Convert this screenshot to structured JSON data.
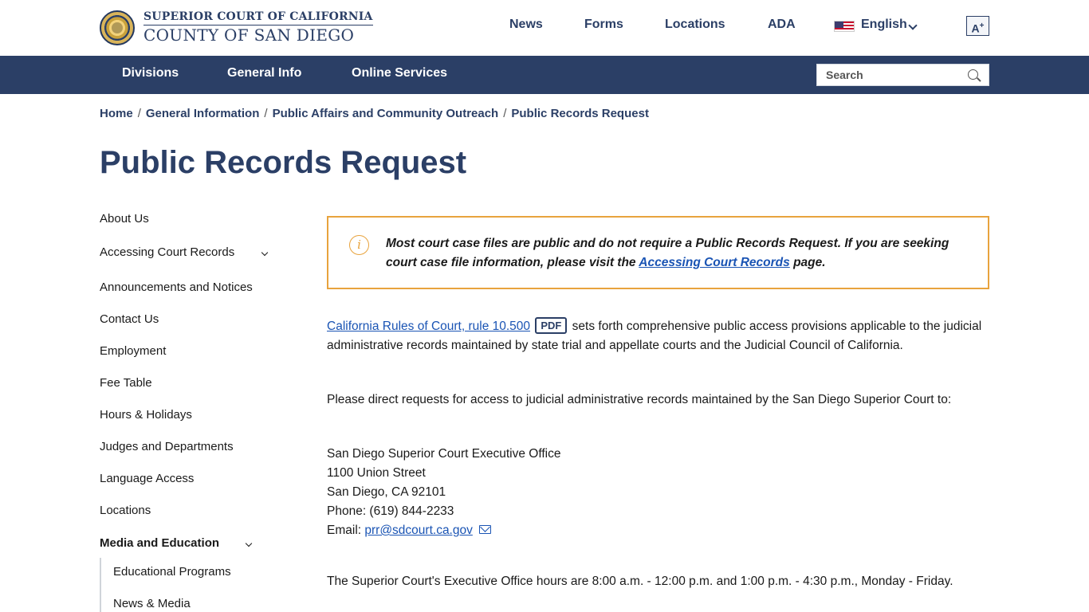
{
  "header": {
    "brand_line1": "SUPERIOR COURT OF CALIFORNIA",
    "brand_line2": "COUNTY OF SAN DIEGO",
    "top_links": [
      "News",
      "Forms",
      "Locations",
      "ADA"
    ],
    "language": "English",
    "font_size_button": "A",
    "font_size_sup": "+"
  },
  "mainnav": {
    "items": [
      "Divisions",
      "General Info",
      "Online Services"
    ],
    "search_placeholder": "Search"
  },
  "breadcrumb": {
    "items": [
      "Home",
      "General Information",
      "Public Affairs and Community Outreach",
      "Public Records Request"
    ],
    "separator": "/"
  },
  "page": {
    "title": "Public Records Request"
  },
  "sidebar": {
    "items": [
      "About Us",
      "Accessing Court Records",
      "Announcements and Notices",
      "Contact Us",
      "Employment",
      "Fee Table",
      "Hours & Holidays",
      "Judges and Departments",
      "Language Access",
      "Locations",
      "Media and Education"
    ],
    "subitems": [
      "Educational Programs",
      "News & Media"
    ]
  },
  "alert": {
    "text_before": "Most court case files are public and do not require a Public Records Request. If you are seeking court case file information, please visit the ",
    "link": "Accessing Court Records",
    "text_after": " page."
  },
  "content": {
    "p1_link": "California Rules of Court, rule 10.500",
    "p1_badge": "PDF",
    "p1_text": " sets forth comprehensive public access provisions applicable to the judicial administrative records maintained by state trial and appellate courts and the Judicial Council of California.",
    "p2": "Please direct requests for access to judicial administrative records maintained by the San Diego Superior Court to:",
    "address": {
      "office": "San Diego Superior Court Executive Office",
      "street": "1100 Union Street",
      "city": "San Diego, CA 92101",
      "phone": "Phone: (619) 844-2233",
      "email_label": "Email: ",
      "email": "prr@sdcourt.ca.gov"
    },
    "p3": "The Superior Court's Executive Office hours are 8:00 a.m. - 12:00 p.m. and 1:00 p.m. - 4:30 p.m., Monday - Friday."
  },
  "colors": {
    "navy": "#2b3f66",
    "alert_border": "#e8a33d",
    "link": "#1a54b4"
  }
}
